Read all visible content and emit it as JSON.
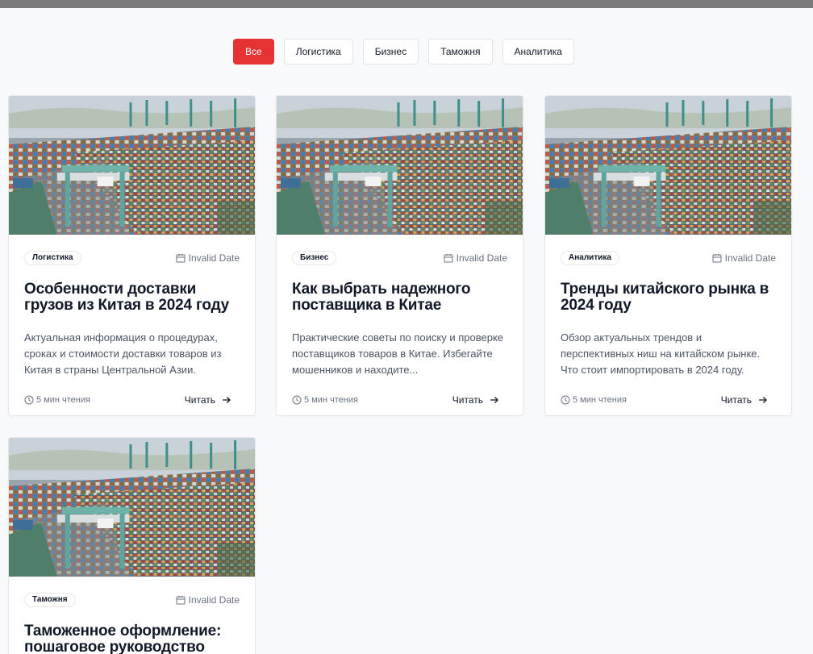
{
  "filters": [
    "Все",
    "Логистика",
    "Бизнес",
    "Таможня",
    "Аналитика"
  ],
  "active_filter": "Все",
  "colors": {
    "accent": "#e53232",
    "background": "#f8f9fa",
    "top_bar": "#7b7b7b"
  },
  "cards": [
    {
      "tag": "Логистика",
      "date": "Invalid Date",
      "title": "Особенности доставки грузов из Китая в 2024 году",
      "description": "Актуальная информация о процедурах, сроках и стоимости доставки товаров из Китая в страны Центральной Азии.",
      "read_time": "5 мин чтения",
      "read_label": "Читать",
      "image": "port-container-terminal-photo"
    },
    {
      "tag": "Бизнес",
      "date": "Invalid Date",
      "title": "Как выбрать надежного поставщика в Китае",
      "description": "Практические советы по поиску и проверке поставщиков товаров в Китае. Избегайте мошенников и находите...",
      "read_time": "5 мин чтения",
      "read_label": "Читать",
      "image": "port-container-terminal-photo"
    },
    {
      "tag": "Аналитика",
      "date": "Invalid Date",
      "title": "Тренды китайского рынка в 2024 году",
      "description": "Обзор актуальных трендов и перспективных ниш на китайском рынке. Что стоит импортировать в 2024 году.",
      "read_time": "5 мин чтения",
      "read_label": "Читать",
      "image": "port-container-terminal-photo"
    },
    {
      "tag": "Таможня",
      "date": "Invalid Date",
      "title": "Таможенное оформление: пошаговое руководство",
      "description": "",
      "read_time": "",
      "read_label": "",
      "image": "port-container-terminal-photo"
    }
  ]
}
